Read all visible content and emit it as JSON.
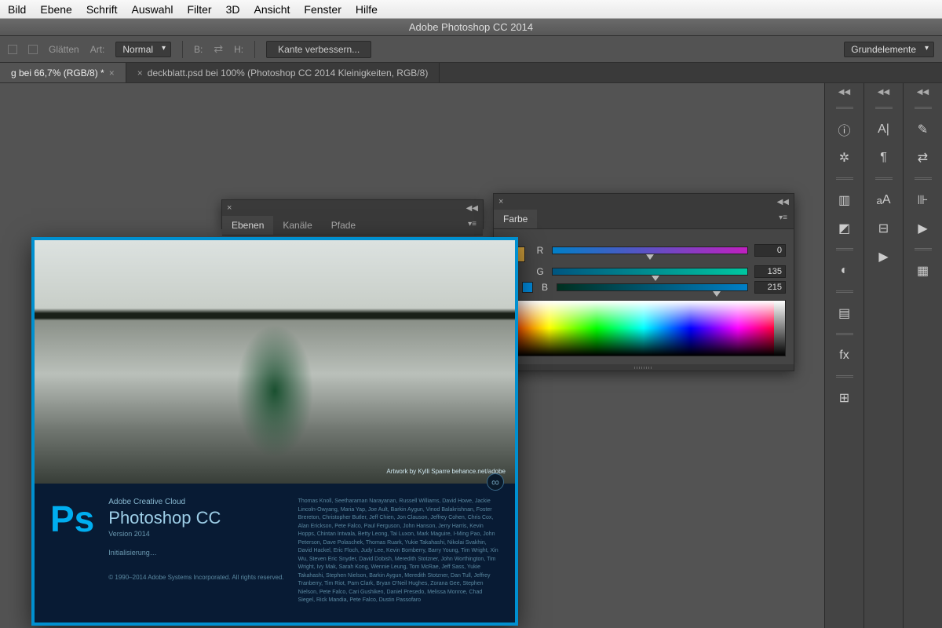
{
  "menubar": [
    "Bild",
    "Ebene",
    "Schrift",
    "Auswahl",
    "Filter",
    "3D",
    "Ansicht",
    "Fenster",
    "Hilfe"
  ],
  "window_title": "Adobe Photoshop CC 2014",
  "options": {
    "glatten": "Glätten",
    "art_label": "Art:",
    "art_value": "Normal",
    "b_label": "B:",
    "h_label": "H:",
    "refine": "Kante verbessern...",
    "workspace": "Grundelemente"
  },
  "tabs": [
    {
      "label": "g bei 66,7% (RGB/8) *",
      "active": true
    },
    {
      "label": "deckblatt.psd bei 100% (Photoshop CC 2014  Kleinigkeiten, RGB/8)",
      "active": false
    }
  ],
  "layers_panel": {
    "tabs": [
      "Ebenen",
      "Kanäle",
      "Pfade"
    ]
  },
  "color_panel": {
    "title": "Farbe",
    "r_label": "R",
    "r_value": "0",
    "g_label": "G",
    "g_value": "135",
    "b_label": "B",
    "b_value": "215"
  },
  "splash": {
    "subtitle": "Adobe Creative Cloud",
    "title": "Photoshop CC",
    "version": "Version 2014",
    "status": "Initialisierung…",
    "copyright": "© 1990–2014 Adobe Systems Incorporated.\nAll rights reserved.",
    "artwork_credit": "Artwork by Kylli Sparre\nbehance.net/adobe",
    "credits": "Thomas Knoll, Seetharaman Narayanan, Russell Williams, David Howe, Jackie Lincoln-Owyang, Maria Yap, Joe Ault, Barkin Aygun, Vinod Balakrishnan, Foster Brereton, Christopher Butler, Jeff Chien, Jon Clauson, Jeffrey Cohen, Chris Cox, Alan Erickson, Pete Falco, Paul Ferguson, John Hanson, Jerry Harris, Kevin Hopps, Chintan Intwala, Betty Leong, Tai Luxon, Mark Maguire, I-Ming Pao, John Peterson, Dave Polaschek, Thomas Ruark, Yukie Takahashi, Nikolai Svakhin, David Hackel, Eric Floch, Judy Lee, Kevin Bomberry, Barry Young, Tim Wright, Xin Wu, Steven Eric Snyder, David Dobish, Meredith Stotzner, John Worthington, Tim Wright, Ivy Mak, Sarah Kong, Wennie Leung, Tom McRae, Jeff Sass, Yukie Takahashi, Stephen Nielson, Barkin Aygun, Meredith Stotzner, Dan Tull, Jeffrey Tranberry, Tim Riot, Pam Clark, Bryan O'Neil Hughes, Zorana Gee, Stephen Nielson, Pete Falco, Cari Gushiken, Daniel Presedo, Melissa Monroe, Chad Siegel, Rick Mandia, Pete Falco, Dustin Passofaro"
  }
}
